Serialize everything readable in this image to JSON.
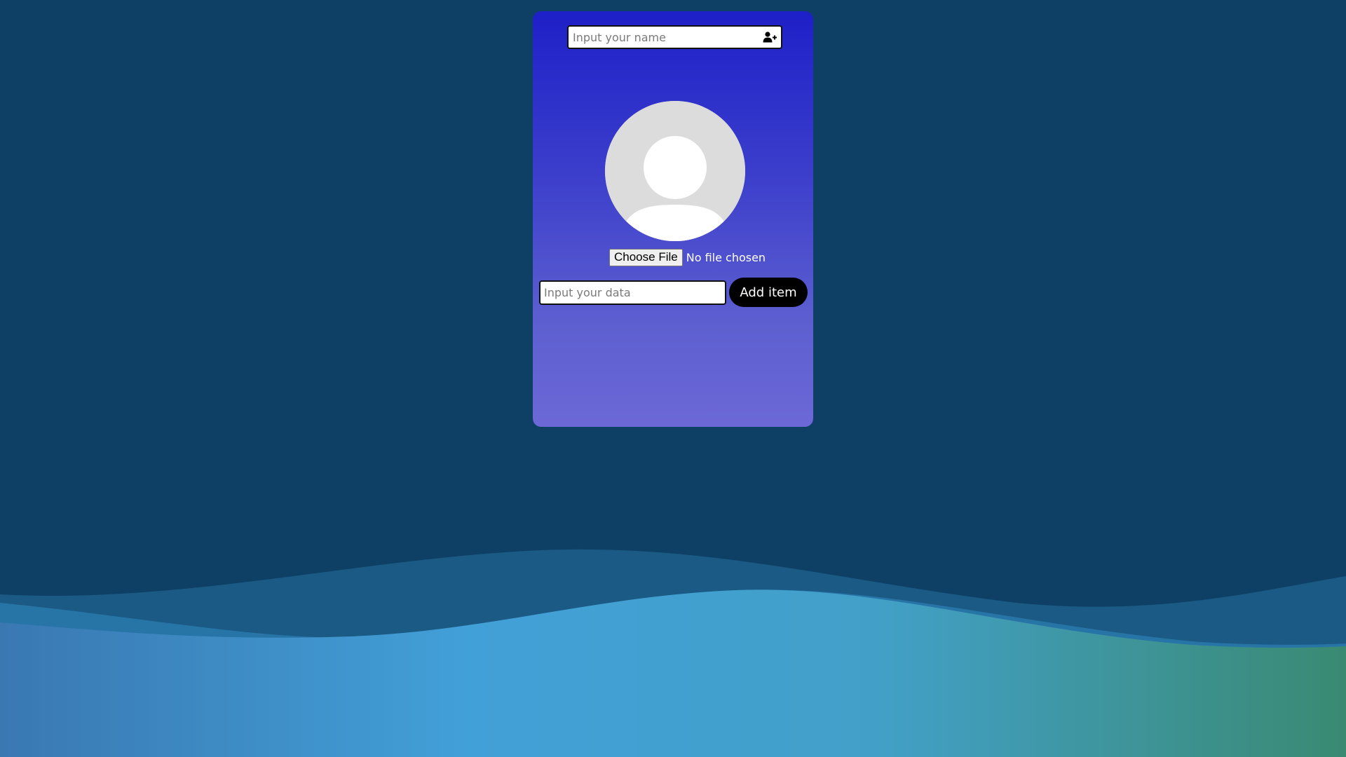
{
  "colors": {
    "page_background": "#0e4066",
    "card_gradient_top": "#1e20c8",
    "card_gradient_bottom": "#6c68d7",
    "button_background": "#000000",
    "wave_left": "#3a78b2",
    "wave_middle": "#42a0d8",
    "wave_right": "#3a8a72"
  },
  "name_field": {
    "placeholder": "Input your name",
    "value": "",
    "icon": "user-plus-icon"
  },
  "avatar": {
    "icon": "default-user-avatar"
  },
  "file_picker": {
    "button_label": "Choose File",
    "status": "No file chosen"
  },
  "data_field": {
    "placeholder": "Input your data",
    "value": ""
  },
  "add_button": {
    "label": "Add item"
  }
}
